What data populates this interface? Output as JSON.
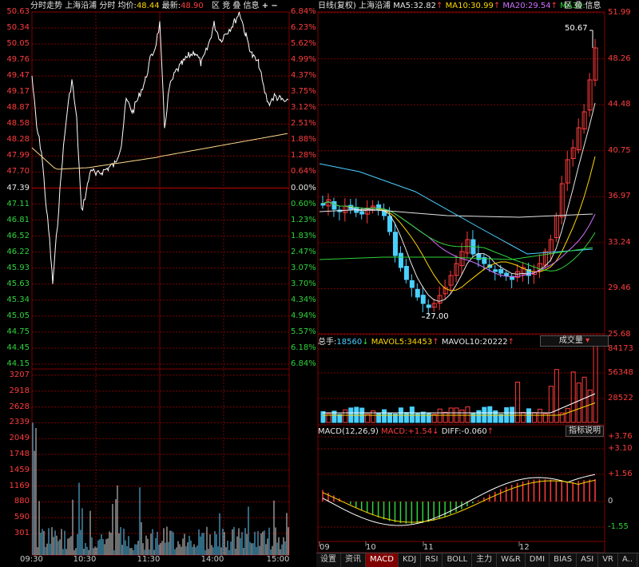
{
  "left": {
    "title": "分时走势",
    "stock": "上海沿浦",
    "mode": "分时",
    "avg_label": "均价:",
    "avg_value": "48.44",
    "last_label": "最新:",
    "last_value": "48.90",
    "tools": [
      "区",
      "竞",
      "叠",
      "信息",
      "+",
      "−"
    ],
    "price_ticks": [
      "50.63",
      "50.34",
      "50.05",
      "49.76",
      "49.47",
      "49.17",
      "48.87",
      "48.58",
      "48.28",
      "47.99",
      "47.70",
      "47.39",
      "47.11",
      "46.81",
      "46.52",
      "46.22",
      "45.93",
      "45.63",
      "45.34",
      "45.05",
      "44.75",
      "44.45",
      "44.15"
    ],
    "pct_ticks": [
      "6.84%",
      "6.23%",
      "5.62%",
      "4.99%",
      "4.37%",
      "3.75%",
      "3.12%",
      "2.51%",
      "1.88%",
      "1.28%",
      "0.64%",
      "0.00%",
      "0.60%",
      "1.23%",
      "1.83%",
      "2.47%",
      "3.07%",
      "3.70%",
      "4.34%",
      "4.94%",
      "5.57%",
      "6.18%",
      "6.84%"
    ],
    "vol_ticks": [
      "3207",
      "2918",
      "2628",
      "2339",
      "2049",
      "1748",
      "1459",
      "1169",
      "880",
      "590",
      "301"
    ],
    "time_ticks": [
      "09:30",
      "10:30",
      "11:30",
      "14:00",
      "15:00"
    ]
  },
  "right": {
    "title": "日线(复权)",
    "stock": "上海沿浦",
    "ma5_label": "MA5:",
    "ma5_value": "32.82",
    "ma10_label": "MA10:",
    "ma10_value": "30.99",
    "ma20_label": "MA20:",
    "ma20_value": "29.54",
    "ma30_label": "MA30:",
    "tools": [
      "区",
      "叠",
      "信息"
    ],
    "price_ticks": [
      "51.99",
      "48.26",
      "44.48",
      "40.75",
      "36.97",
      "33.24",
      "29.46",
      "25.68"
    ],
    "high_marker": "50.67",
    "low_marker": "27.00",
    "vol_header": {
      "total_label": "总手:",
      "total_value": "18560",
      "mavol5_label": "MAVOL5:",
      "mavol5_value": "34453",
      "mavol10_label": "MAVOL10:",
      "mavol10_value": "20222"
    },
    "vol_select": "成交量",
    "vol_ticks": [
      "84173",
      "56348",
      "28522"
    ],
    "macd_header": {
      "params": "MACD(12,26,9)",
      "macd_label": "MACD:",
      "macd_value": "+1.54",
      "diff_label": "DIFF:",
      "diff_value": "-0.060"
    },
    "macd_button": "指标说明",
    "macd_ticks": [
      "+3.76",
      "+3.10",
      "+1.56",
      "0",
      "-1.55"
    ],
    "date_ticks": [
      "09",
      "10",
      "11",
      "12"
    ],
    "tabs": [
      "设置",
      "资讯",
      "MACD",
      "KDJ",
      "RSI",
      "BOLL",
      "主力",
      "W&R",
      "DMI",
      "BIAS",
      "ASI",
      "VR",
      "A.."
    ],
    "active_tab": "MACD"
  },
  "colors": {
    "up": "#ff3c3c",
    "down": "#2fd33a",
    "grid": "#800000",
    "ma5": "#e6e6e6",
    "ma10": "#ffd700",
    "ma20": "#d070ff",
    "ma30": "#2fd33a"
  }
}
